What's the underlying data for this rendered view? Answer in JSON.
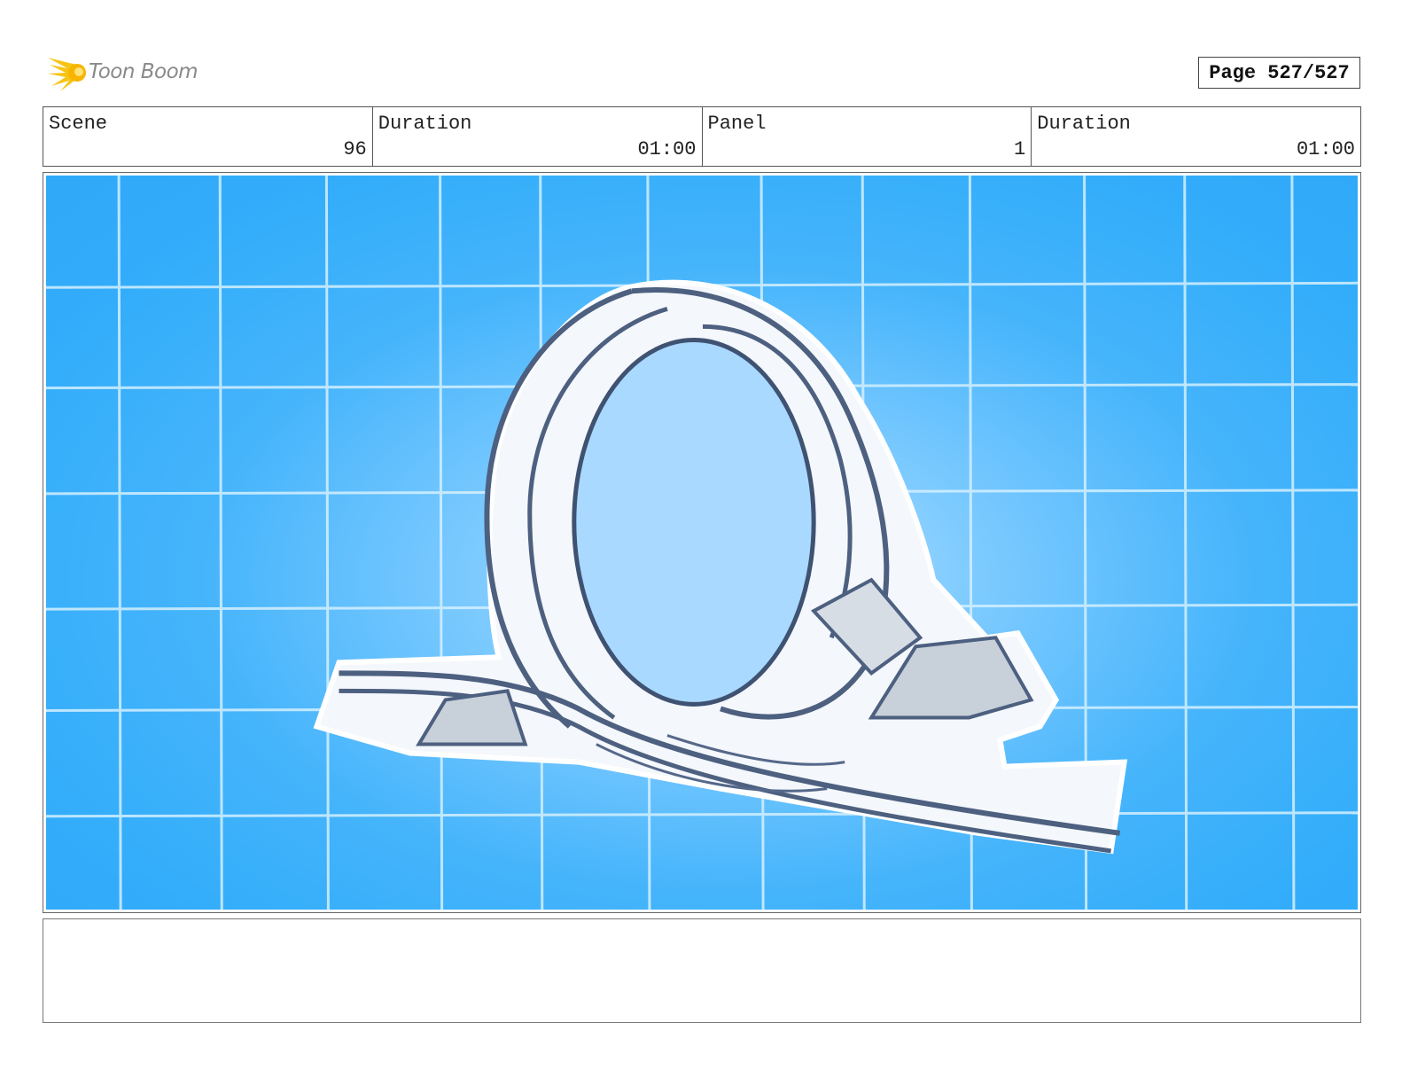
{
  "header": {
    "logo_text": "Toon Boom",
    "page_label": "Page 527/527"
  },
  "info": [
    {
      "label": "Scene",
      "value": "96"
    },
    {
      "label": "Duration",
      "value": "01:00"
    },
    {
      "label": "Panel",
      "value": "1"
    },
    {
      "label": "Duration",
      "value": "01:00"
    }
  ],
  "panel": {
    "image": "roller-coaster-loop-sketch",
    "background_color": "#33adfa",
    "grid_color": "#cfeeff"
  },
  "notes": {
    "text": ""
  }
}
